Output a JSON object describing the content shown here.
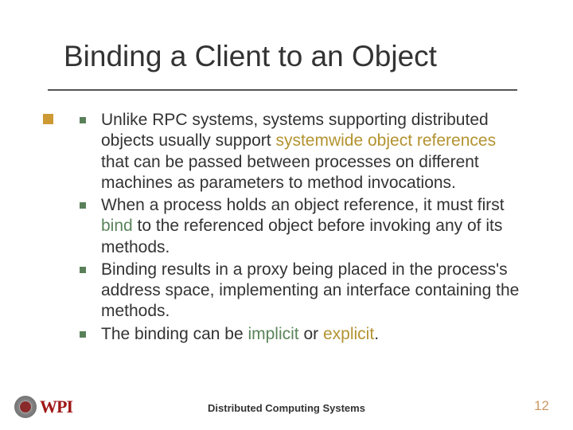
{
  "title": "Binding a Client to an Object",
  "bullets": [
    {
      "pre": "Unlike RPC systems, systems supporting distributed objects usually support ",
      "hl1": "systemwide object references",
      "hl1_class": "hl-y",
      "post": " that can be passed between processes on different machines as parameters to method invocations."
    },
    {
      "pre": "When a process holds an object reference, it must first ",
      "hl1": "bind",
      "hl1_class": "hl-g",
      "post": " to the referenced object before invoking any of its methods."
    },
    {
      "pre": "Binding results in a proxy being placed in the process's address space, implementing an interface containing the methods.",
      "hl1": "",
      "hl1_class": "",
      "post": ""
    },
    {
      "pre": "The binding can be ",
      "hl1": "implicit",
      "hl1_class": "hl-g",
      "mid": " or ",
      "hl2": "explicit",
      "hl2_class": "hl-y",
      "post": "."
    }
  ],
  "footer": "Distributed Computing Systems",
  "page": "12",
  "logo_text": "WPI"
}
